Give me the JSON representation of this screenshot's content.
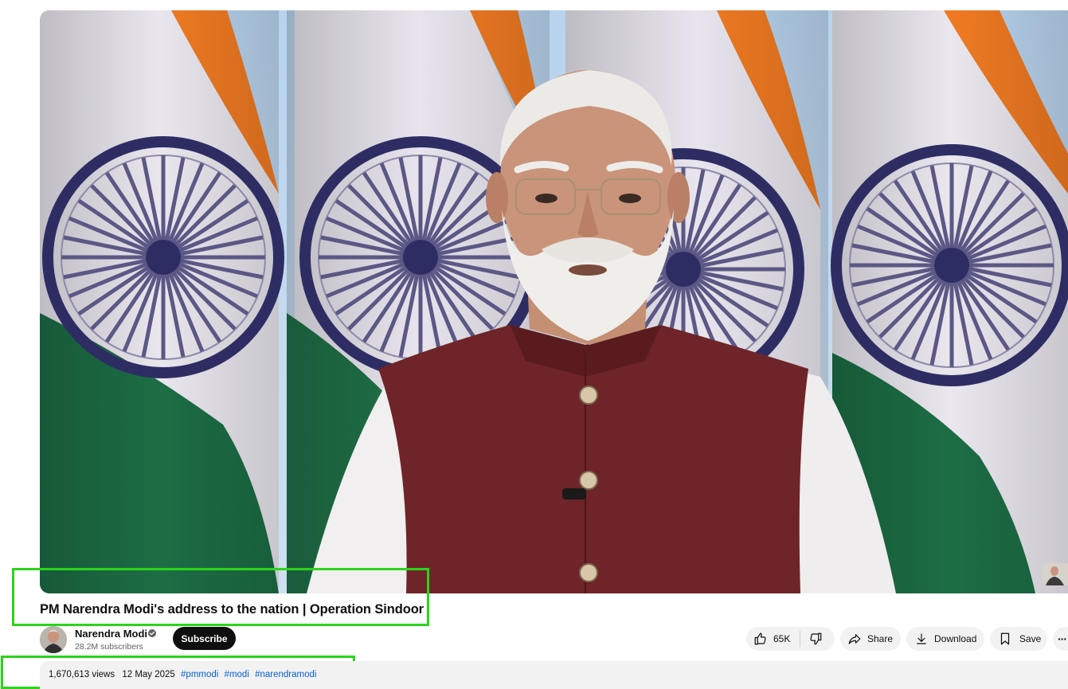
{
  "video": {
    "title": "PM Narendra Modi's address to the nation | Operation Sindoor"
  },
  "channel": {
    "name": "Narendra Modi",
    "subscribers": "28.2M subscribers",
    "subscribe_label": "Subscribe"
  },
  "actions": {
    "likes": "65K",
    "share_label": "Share",
    "download_label": "Download",
    "save_label": "Save",
    "more_label": "···"
  },
  "description": {
    "views": "1,670,613 views",
    "date": "12 May 2025",
    "hashtags": [
      "#pmmodi",
      "#modi",
      "#narendramodi"
    ]
  },
  "colors": {
    "highlight_box": "#2bd41b",
    "subscribe_bg": "#0f0f0f",
    "hashtag": "#065fd4",
    "pill_bg": "#f2f2f2"
  },
  "icons": [
    "like-icon",
    "dislike-icon",
    "share-icon",
    "download-icon",
    "save-icon",
    "more-icon",
    "verified-icon"
  ]
}
